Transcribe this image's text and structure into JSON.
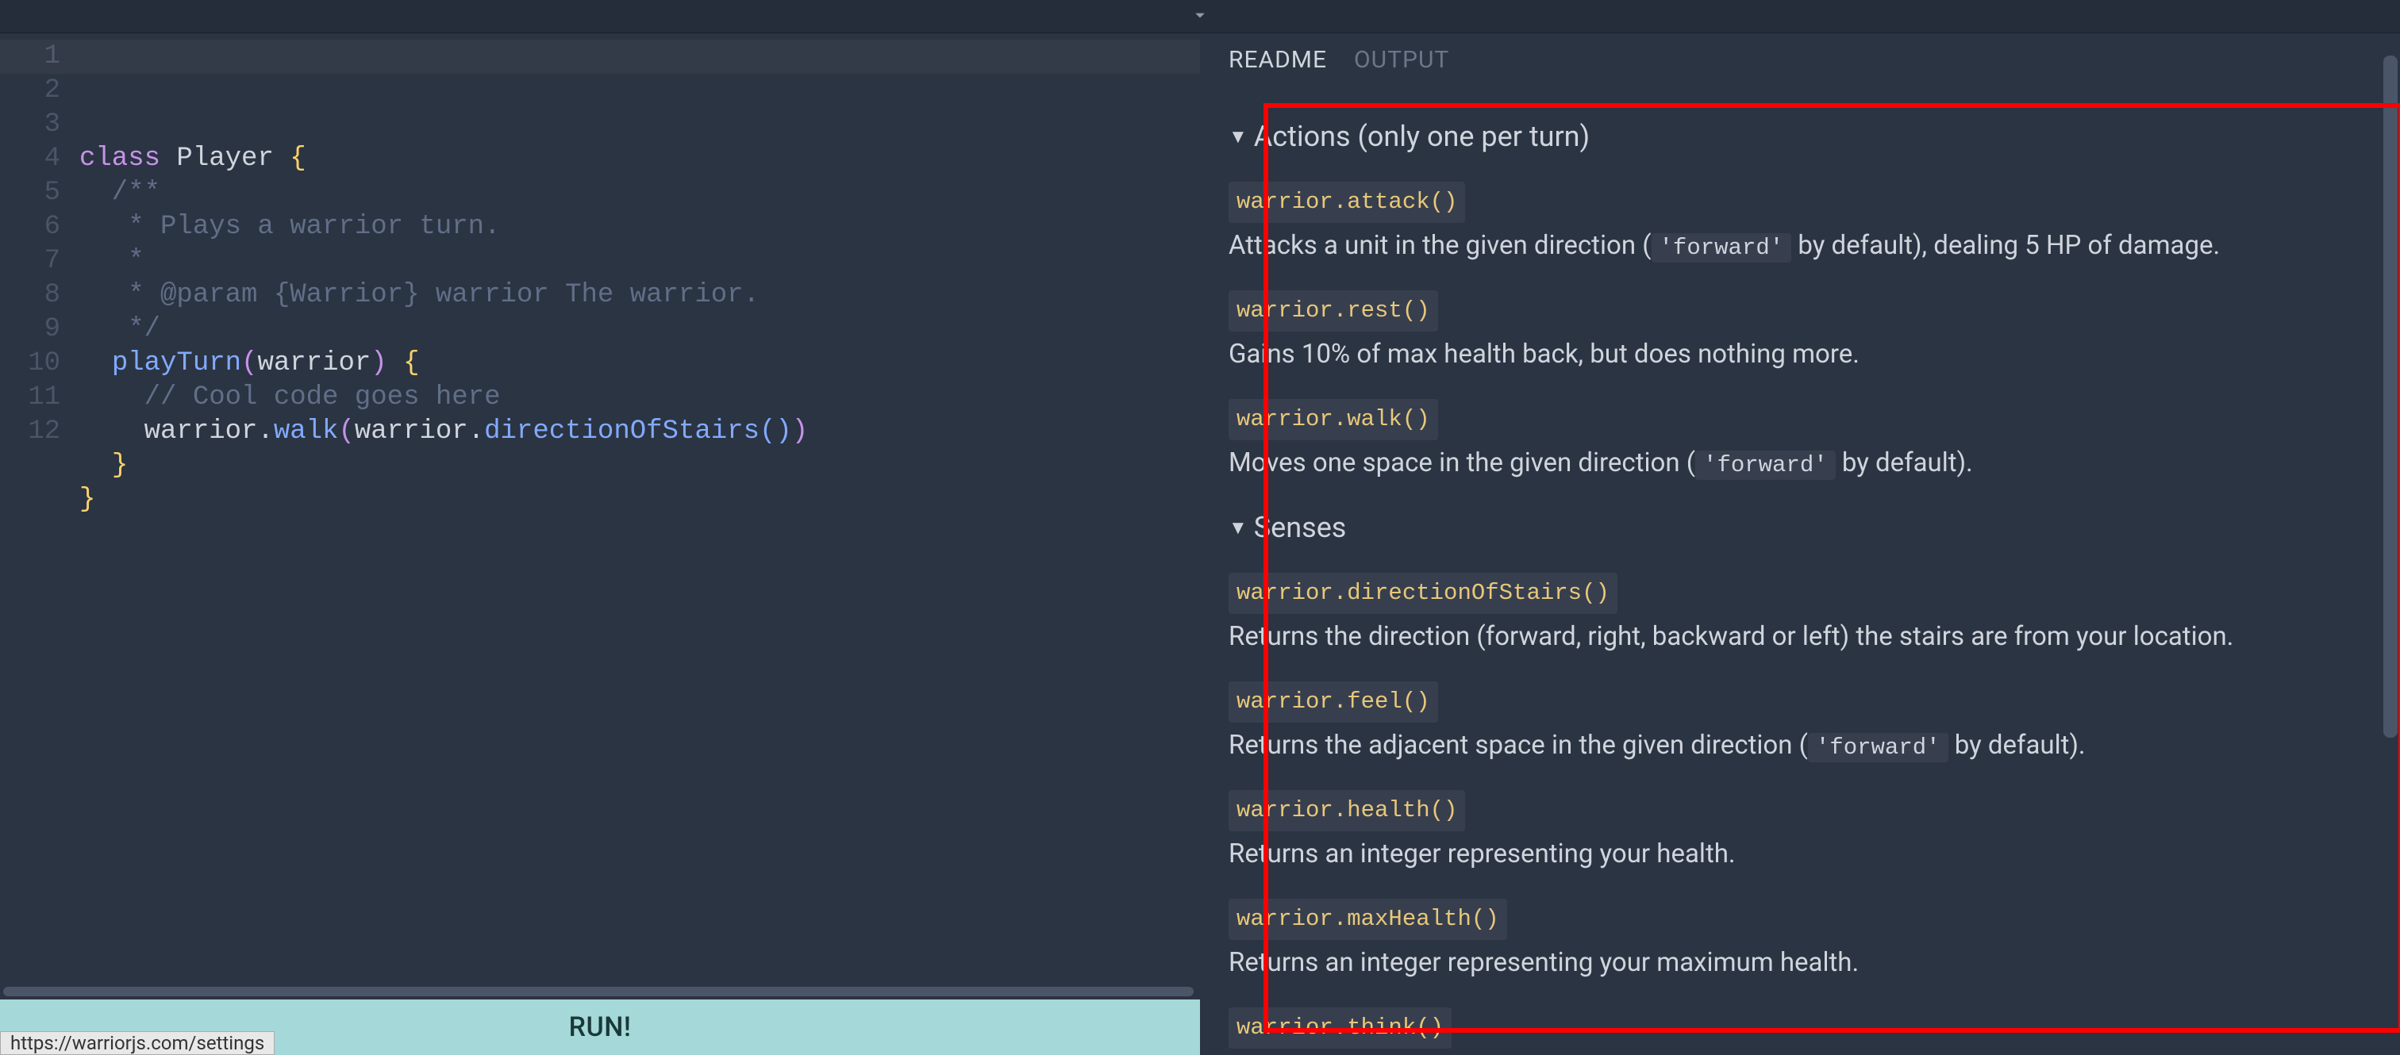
{
  "topbar": {
    "collapse_icon": "chevron-down"
  },
  "editor": {
    "lines": [
      {
        "n": 1,
        "tokens": [
          {
            "t": "class ",
            "c": "keyword"
          },
          {
            "t": "Player ",
            "c": "identifier"
          },
          {
            "t": "{",
            "c": "brace"
          }
        ]
      },
      {
        "n": 2,
        "tokens": [
          {
            "t": "  /**",
            "c": "comment"
          }
        ]
      },
      {
        "n": 3,
        "tokens": [
          {
            "t": "   * Plays a warrior turn.",
            "c": "comment"
          }
        ]
      },
      {
        "n": 4,
        "tokens": [
          {
            "t": "   *",
            "c": "comment"
          }
        ]
      },
      {
        "n": 5,
        "tokens": [
          {
            "t": "   * @param {Warrior} warrior The warrior.",
            "c": "comment"
          }
        ]
      },
      {
        "n": 6,
        "tokens": [
          {
            "t": "   */",
            "c": "comment"
          }
        ]
      },
      {
        "n": 7,
        "tokens": [
          {
            "t": "  ",
            "c": ""
          },
          {
            "t": "playTurn",
            "c": "func"
          },
          {
            "t": "(",
            "c": "paren"
          },
          {
            "t": "warrior",
            "c": "identifier"
          },
          {
            "t": ")",
            "c": "paren"
          },
          {
            "t": " ",
            "c": ""
          },
          {
            "t": "{",
            "c": "brace"
          }
        ]
      },
      {
        "n": 8,
        "tokens": [
          {
            "t": "    // Cool code goes here",
            "c": "comment"
          }
        ]
      },
      {
        "n": 9,
        "tokens": [
          {
            "t": "    warrior.",
            "c": "identifier"
          },
          {
            "t": "walk",
            "c": "func"
          },
          {
            "t": "(",
            "c": "paren"
          },
          {
            "t": "warrior.",
            "c": "identifier"
          },
          {
            "t": "directionOfStairs",
            "c": "func"
          },
          {
            "t": "(",
            "c": "paren2"
          },
          {
            "t": ")",
            "c": "paren2"
          },
          {
            "t": ")",
            "c": "paren"
          }
        ]
      },
      {
        "n": 10,
        "tokens": [
          {
            "t": "  ",
            "c": ""
          },
          {
            "t": "}",
            "c": "brace"
          }
        ]
      },
      {
        "n": 11,
        "tokens": [
          {
            "t": "}",
            "c": "brace"
          }
        ]
      },
      {
        "n": 12,
        "tokens": []
      }
    ]
  },
  "run_button_label": "RUN!",
  "status_url": "https://warriorjs.com/settings",
  "tabs": {
    "readme": "README",
    "output": "OUTPUT",
    "active": "readme"
  },
  "readme": {
    "sections": [
      {
        "title": "Actions (only one per turn)",
        "items": [
          {
            "code": "warrior.attack()",
            "desc_parts": [
              {
                "text": "Attacks a unit in the given direction ("
              },
              {
                "code": "'forward'"
              },
              {
                "text": " by default), dealing 5 HP of damage."
              }
            ]
          },
          {
            "code": "warrior.rest()",
            "desc_parts": [
              {
                "text": "Gains 10% of max health back, but does nothing more."
              }
            ]
          },
          {
            "code": "warrior.walk()",
            "desc_parts": [
              {
                "text": "Moves one space in the given direction ("
              },
              {
                "code": "'forward'"
              },
              {
                "text": " by default)."
              }
            ]
          }
        ]
      },
      {
        "title": "Senses",
        "items": [
          {
            "code": "warrior.directionOfStairs()",
            "desc_parts": [
              {
                "text": "Returns the direction (forward, right, backward or left) the stairs are from your location."
              }
            ]
          },
          {
            "code": "warrior.feel()",
            "desc_parts": [
              {
                "text": "Returns the adjacent space in the given direction ("
              },
              {
                "code": "'forward'"
              },
              {
                "text": " by default)."
              }
            ]
          },
          {
            "code": "warrior.health()",
            "desc_parts": [
              {
                "text": "Returns an integer representing your health."
              }
            ]
          },
          {
            "code": "warrior.maxHealth()",
            "desc_parts": [
              {
                "text": "Returns an integer representing your maximum health."
              }
            ]
          },
          {
            "code": "warrior.think()",
            "desc_parts": []
          }
        ]
      }
    ]
  }
}
